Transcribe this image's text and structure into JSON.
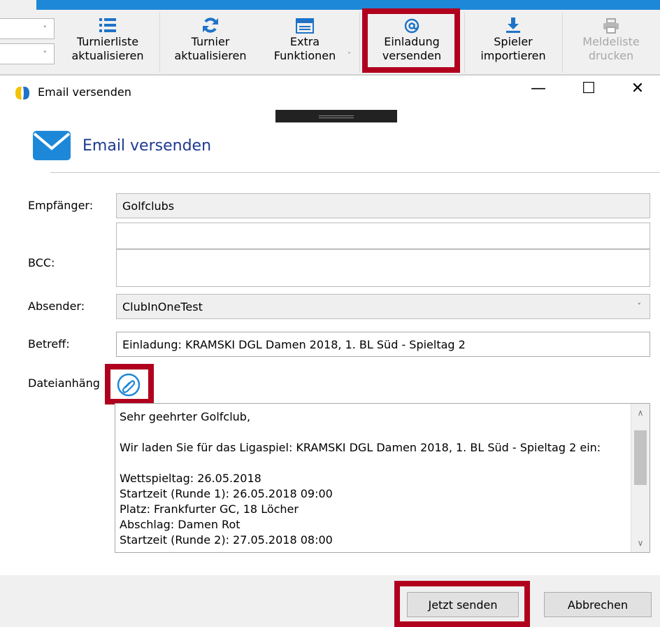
{
  "ribbon": {
    "buttons": [
      {
        "line1": "Turnierliste",
        "line2": "aktualisieren",
        "icon": "list-icon"
      },
      {
        "line1": "Turnier",
        "line2": "aktualisieren",
        "icon": "refresh-icon"
      },
      {
        "line1": "Extra",
        "line2": "Funktionen",
        "icon": "window-icon"
      },
      {
        "line1": "Einladung",
        "line2": "versenden",
        "icon": "at-sign-icon"
      },
      {
        "line1": "Spieler",
        "line2": "importieren",
        "icon": "download-icon"
      },
      {
        "line1": "Meldeliste",
        "line2": "drucken",
        "icon": "printer-icon"
      }
    ],
    "dropdown_arrow": "˅",
    "combo_arrow": "˅"
  },
  "window": {
    "title": "Email versenden",
    "minimize": "—",
    "maximize": "☐",
    "close": "✕"
  },
  "dialog": {
    "header_title": "Email versenden",
    "recipient_label": "Empfänger:",
    "recipient_value": "Golfclubs",
    "bcc_label": "BCC:",
    "sender_label": "Absender:",
    "sender_value": "ClubInOneTest",
    "sender_arrow": "˅",
    "subject_label": "Betreff:",
    "subject_value": "Einladung: KRAMSKI DGL Damen 2018, 1. BL Süd - Spieltag 2",
    "attachments_label": "Dateianhäng",
    "body_lines": [
      "Sehr geehrter Golfclub,",
      "",
      "Wir laden Sie für das Ligaspiel: KRAMSKI DGL Damen 2018, 1. BL Süd - Spieltag 2 ein:",
      "",
      "Wettspieltag: 26.05.2018",
      "Startzeit (Runde 1): 26.05.2018 09:00",
      "Platz: Frankfurter GC, 18 Löcher",
      "Abschlag: Damen Rot",
      "Startzeit (Runde 2): 27.05.2018 08:00"
    ],
    "scroll_up": "∧",
    "scroll_down": "∨"
  },
  "footer": {
    "send_label": "Jetzt senden",
    "cancel_label": "Abbrechen"
  },
  "colors": {
    "accent_blue": "#1e88d8",
    "highlight_red": "#b0001e",
    "header_text": "#1c3a8f"
  }
}
